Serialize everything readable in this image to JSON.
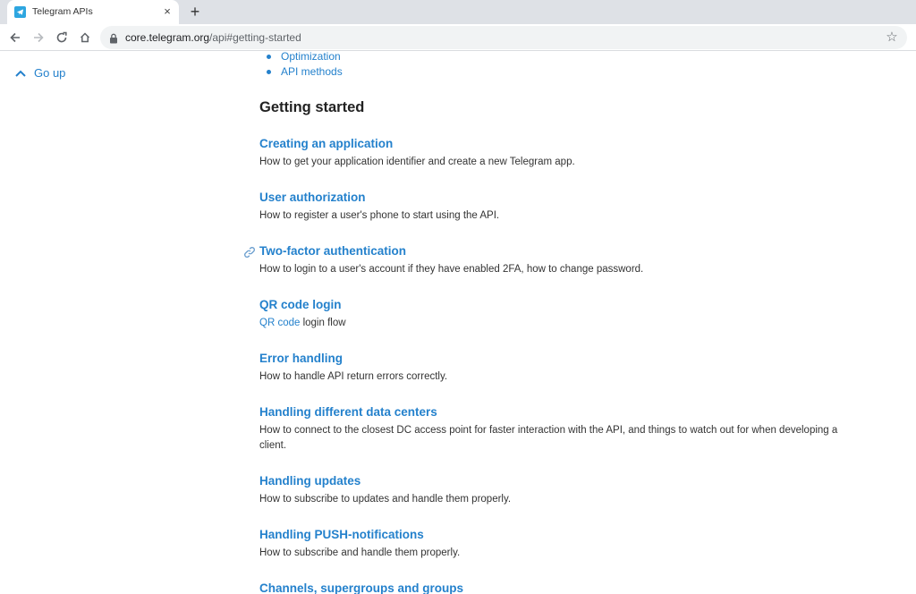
{
  "browser": {
    "tab_title": "Telegram APIs",
    "tab_close": "×",
    "new_tab": "+",
    "url_host": "core.telegram.org",
    "url_path": "/api#getting-started"
  },
  "sidebar": {
    "go_up": "Go up"
  },
  "toc": [
    "Optimization",
    "API methods"
  ],
  "heading": "Getting started",
  "sections": [
    {
      "title": "Creating an application",
      "desc": "How to get your application identifier and create a new Telegram app."
    },
    {
      "title": "User authorization",
      "desc": "How to register a user's phone to start using the API."
    },
    {
      "title": "Two-factor authentication",
      "desc": "How to login to a user's account if they have enabled 2FA, how to change password."
    },
    {
      "title": "QR code login",
      "desc_link": "QR code",
      "desc_rest": " login flow"
    },
    {
      "title": "Error handling",
      "desc": "How to handle API return errors correctly."
    },
    {
      "title": "Handling different data centers",
      "desc": "How to connect to the closest DC access point for faster interaction with the API, and things to watch out for when developing a client."
    },
    {
      "title": "Handling updates",
      "desc": "How to subscribe to updates and handle them properly."
    },
    {
      "title": "Handling PUSH-notifications",
      "desc": "How to subscribe and handle them properly."
    },
    {
      "title": "Channels, supergroups and groups"
    }
  ],
  "colors": {
    "link": "#2481cc",
    "tabstrip": "#dee1e6",
    "telegram": "#2ea6e0"
  }
}
